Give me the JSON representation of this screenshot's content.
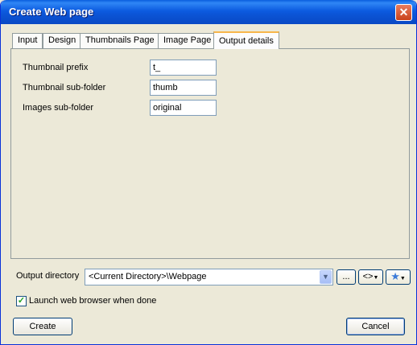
{
  "window": {
    "title": "Create Web page",
    "close_glyph": "✕"
  },
  "tabs": [
    {
      "label": "Input"
    },
    {
      "label": "Design"
    },
    {
      "label": "Thumbnails Page"
    },
    {
      "label": "Image Page"
    },
    {
      "label": "Output details",
      "active": true
    }
  ],
  "fields": {
    "thumbnail_prefix": {
      "label": "Thumbnail prefix",
      "value": "t_"
    },
    "thumbnail_subfolder": {
      "label": "Thumbnail sub-folder",
      "value": "thumb"
    },
    "images_subfolder": {
      "label": "Images sub-folder",
      "value": "original"
    }
  },
  "output": {
    "label": "Output directory",
    "value": "<Current Directory>\\Webpage",
    "browse_label": "...",
    "code_label": "<>",
    "favorites_icon": "star-icon"
  },
  "launch": {
    "label": "Launch web browser when done",
    "checked": true
  },
  "buttons": {
    "create": "Create",
    "cancel": "Cancel"
  }
}
